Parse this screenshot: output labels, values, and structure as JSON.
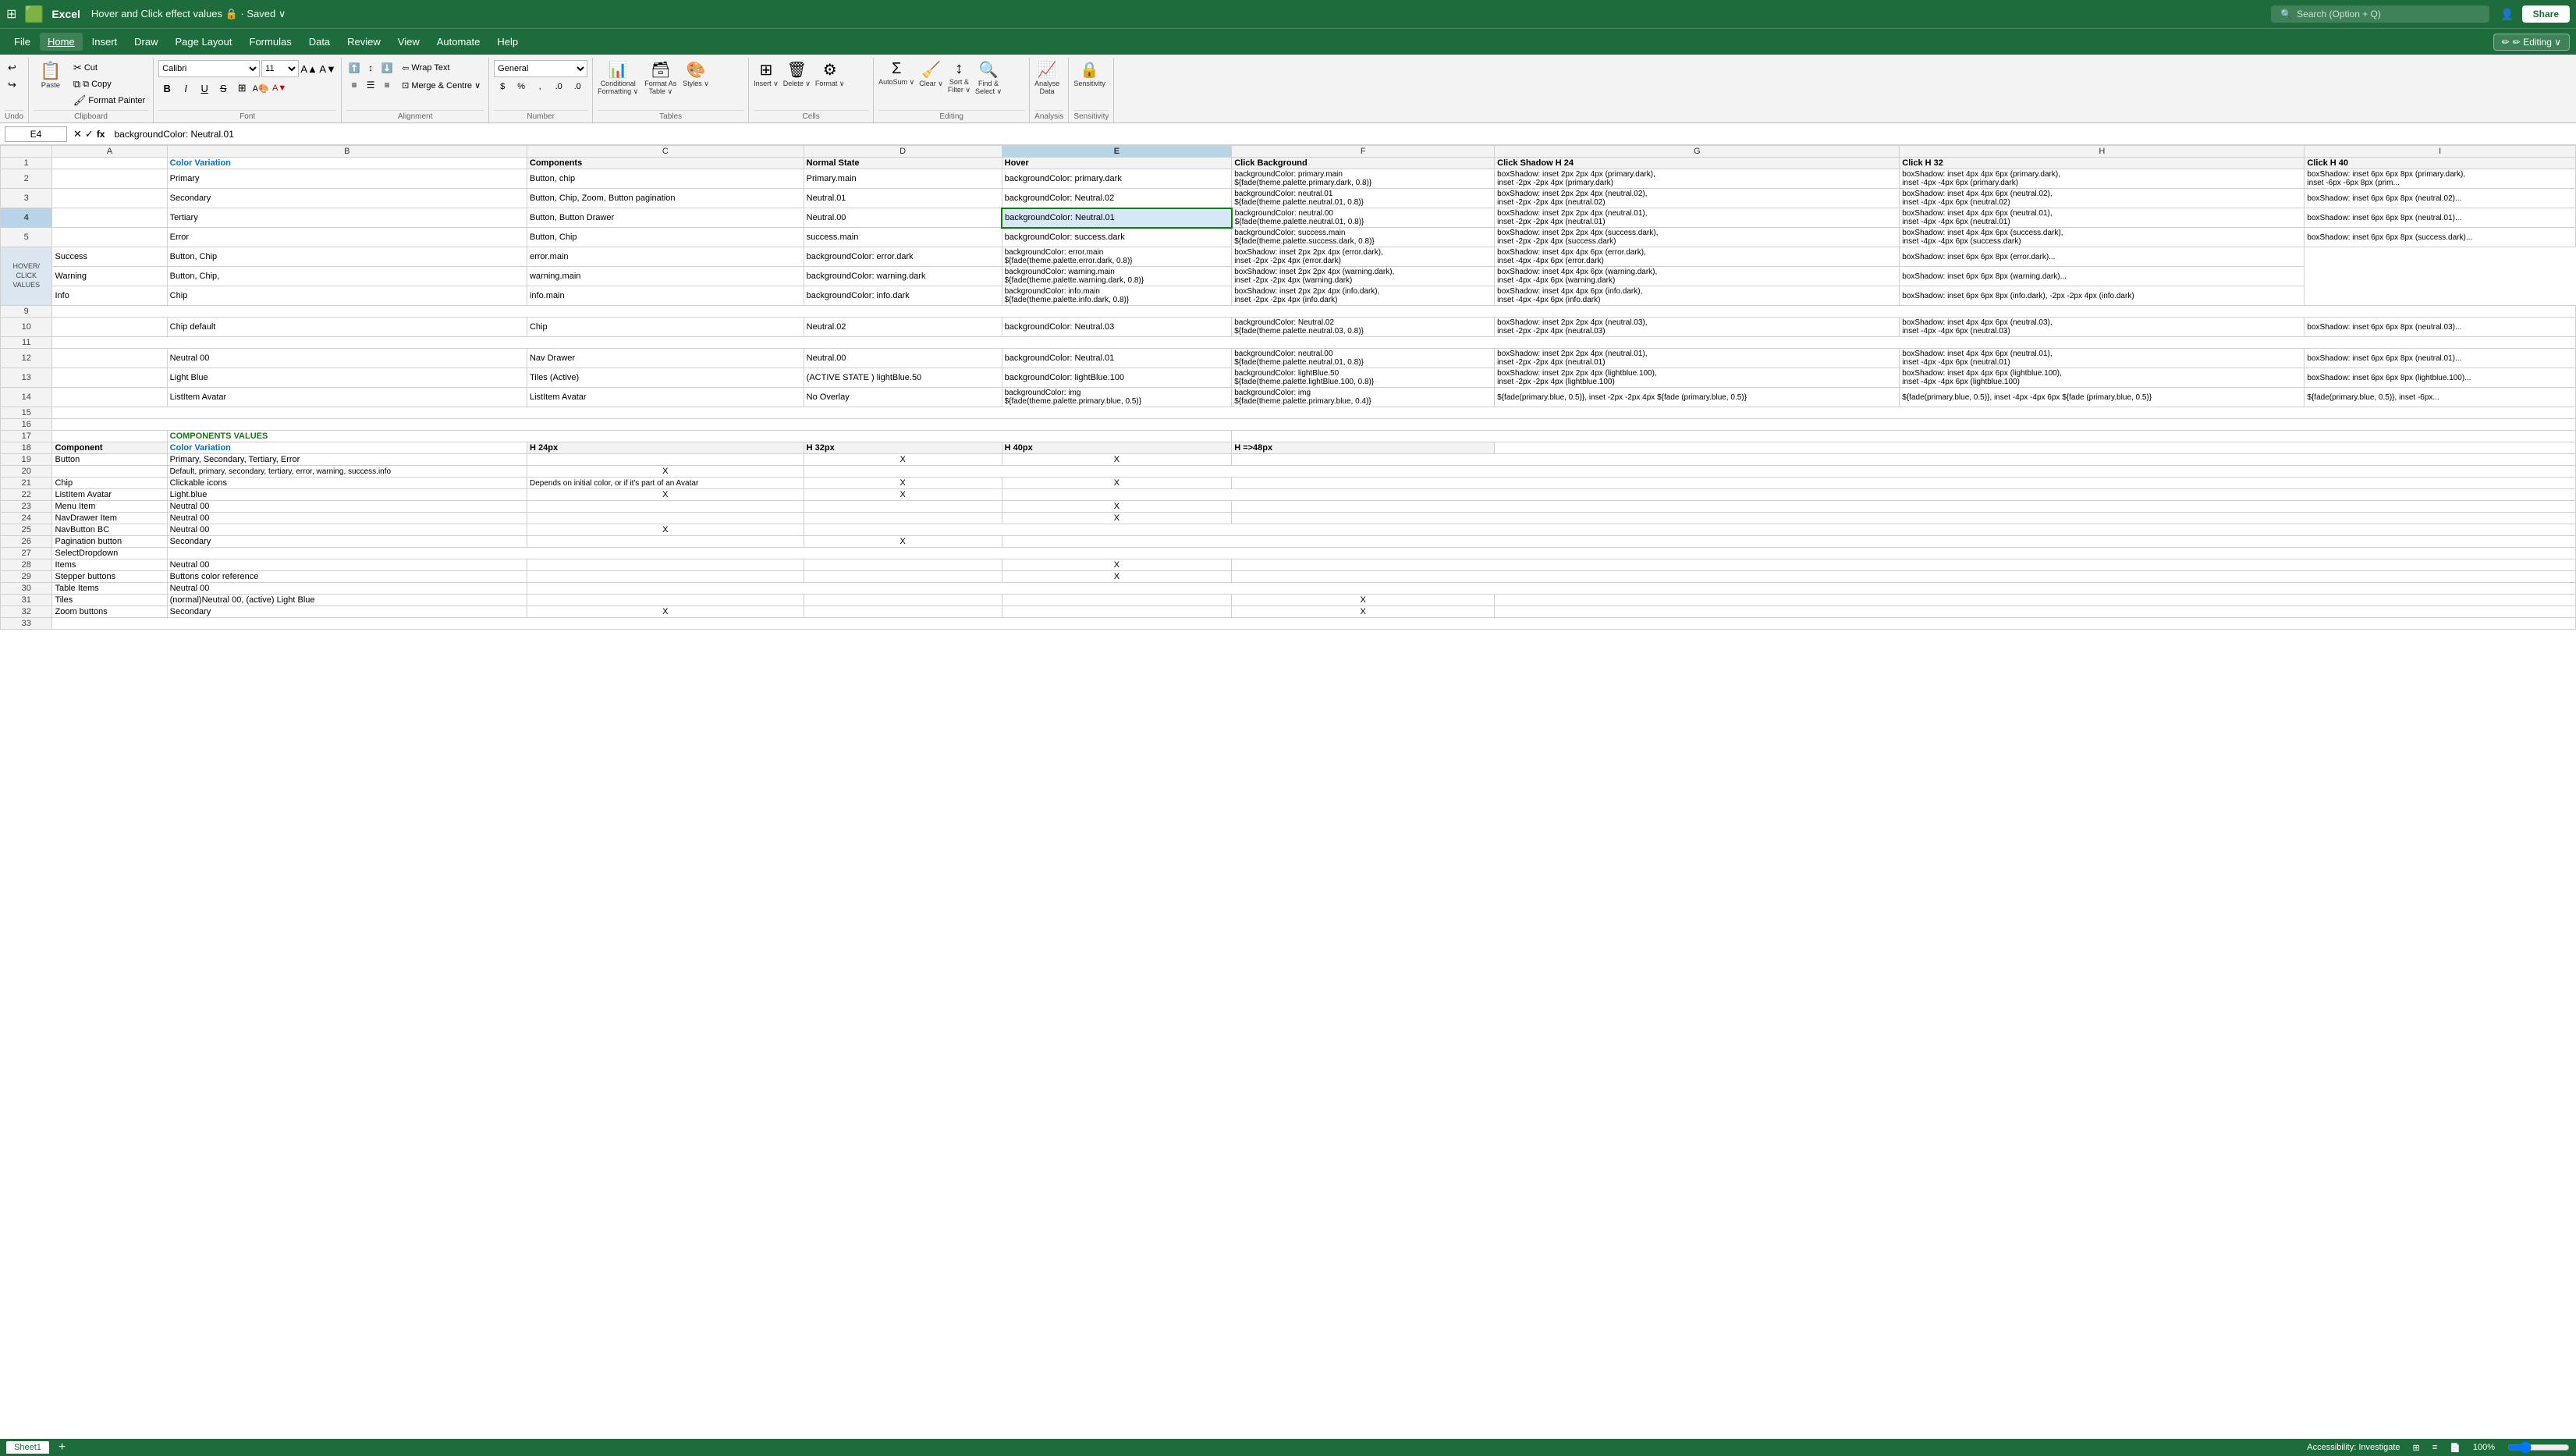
{
  "titleBar": {
    "appIcon": "⊞",
    "appName": "Excel",
    "docTitle": "Hover and Click effect values  🔒 · Saved ∨",
    "searchPlaceholder": "Search (Option + Q)",
    "shareLabel": "Share",
    "editingLabel": "✏ Editing ∨"
  },
  "menuBar": {
    "items": [
      "File",
      "Home",
      "Insert",
      "Draw",
      "Page Layout",
      "Formulas",
      "Data",
      "Review",
      "View",
      "Automate",
      "Help"
    ]
  },
  "ribbon": {
    "groups": {
      "undo": {
        "label": "Undo",
        "items": [
          "↩ Undo",
          "↪ Redo"
        ]
      },
      "clipboard": {
        "label": "Clipboard",
        "paste": "Paste",
        "cut": "✂ Cut",
        "copy": "⧉ Copy",
        "painter": "🖌 Format Painter"
      },
      "font": {
        "label": "Font",
        "name": "Calibri",
        "size": "11"
      },
      "alignment": {
        "label": "Alignment"
      },
      "wrapText": "Wrap Text",
      "mergeCentre": "Merge & Centre",
      "number": {
        "label": "Number",
        "format": "General"
      },
      "tables": {
        "label": "Tables"
      },
      "cells": {
        "label": "Cells"
      },
      "editing": {
        "label": "Editing",
        "autosum": "AutoSum",
        "clear": "Clear",
        "sortFilter": "Sort & Filter",
        "findSelect": "Find & Select"
      },
      "analysis": {
        "label": "Analysis",
        "analyseData": "Analyse Data"
      },
      "sensitivity": {
        "label": "Sensitivity"
      }
    }
  },
  "formulaBar": {
    "cellRef": "E4",
    "formula": "backgroundColor: Neutral.01"
  },
  "columns": {
    "widths": [
      28,
      80,
      160,
      260,
      130,
      195,
      180,
      175,
      185,
      140
    ],
    "labels": [
      "",
      "A",
      "B",
      "C",
      "D",
      "E",
      "F",
      "G",
      "H"
    ]
  },
  "rows": {
    "headers": [
      "1",
      "2",
      "3",
      "4",
      "5",
      "6",
      "7",
      "8",
      "9",
      "10",
      "11",
      "12",
      "13",
      "14",
      "15",
      "16",
      "17",
      "18",
      "19",
      "20",
      "21",
      "22",
      "23",
      "24",
      "25",
      "26",
      "27",
      "28",
      "29",
      "30",
      "31",
      "32",
      "33"
    ]
  },
  "spreadsheet": {
    "row1": {
      "A": "",
      "B": "Color Variation",
      "C": "Components",
      "D": "Normal State",
      "E": "Hover",
      "F": "Click Background",
      "G": "Click Shadow H 24",
      "H": "Click H 32",
      "I": "Click H 40"
    },
    "row2": {
      "B": "Primary",
      "C": "Button, chip",
      "D": "Primary.main",
      "E": "backgroundColor: primary.dark",
      "F": "backgroundColor: primary.main\n${fade(theme.palette.primary.dark, 0.8)}",
      "G": "boxShadow: inset 2px 2px 4px (primary.dark), inset -2px -2px 4px (primary.dark)",
      "H": "boxShadow: inset 4px 4px 6px (primary.dark), inset -4px -4px 6px (primary.dark)",
      "I": "boxShadow: inset 6px 6px 8px (primary.dark), inset -6px -6px 8px (prim..."
    },
    "row3": {
      "B": "Secondary",
      "C": "Button, Chip, Zoom, Button pagination",
      "D": "Neutral.01",
      "E": "backgroundColor: Neutral.02",
      "F": "backgroundColor: neutral.01\n${fade(theme.palette.neutral.01, 0.8)}",
      "G": "boxShadow: inset 2px 2px 4px (neutral.02), inset -2px -2px 4px (neutral.02)",
      "H": "boxShadow: inset 4px 4px 6px (neutral.02), inset -4px -4px 6px (neutral.02)",
      "I": "boxShadow: inset 6px 6px 8px (neutral.02), inset -6px -6px..."
    },
    "row4": {
      "B": "Tertiary",
      "C": "Button, Button Drawer",
      "D": "Neutral.00",
      "E": "backgroundColor: Neutral.01",
      "F": "backgroundColor: neutral.00\n${fade(theme.palette.neutral.01, 0.8)}",
      "G": "boxShadow: inset 2px 2px 4px (neutral.01), inset -2px -2px 4px (neutral.01)",
      "H": "boxShadow: inset 4px 4px 6px (neutral.01), inset -4px -4px 6px (neutral.01)",
      "I": "boxShadow: inset 6px 6px 8px (neutral.01),..."
    },
    "row5": {
      "B": "Error",
      "C": "Button, Chip",
      "D": "success.main",
      "E": "backgroundColor: success.dark",
      "F": "backgroundColor: success.main\n${fade(theme.palette.success.dark, 0.8)}",
      "G": "boxShadow: inset 2px 2px 4px (success.dark), inset -2px -2px 4px (success.dark)",
      "H": "boxShadow: inset 4px 4px 6px (success.dark), inset -4px -4px 6px (success.dark)",
      "I": "boxShadow: inset 6px 6px 8px (success.dark),..."
    },
    "row6": {
      "A": "HOVER/ CLICK VALUES",
      "B": "Success",
      "C": "Button, Chip",
      "D": "error.main",
      "E": "backgroundColor: error.dark",
      "F": "backgroundColor: error.main\n${fade(theme.palette.error.dark, 0.8)}",
      "G": "boxShadow: inset 2px 2px 4px (error.dark), inset -2px -2px 4px (error.dark)",
      "H": "boxShadow: inset 4px 4px 6px (error.dark), inset -4px -4px 6px (error.dark)",
      "I": "boxShadow: inset 6px 6px 8px (error.dark),..."
    },
    "row7": {
      "B": "Warning",
      "C": "Button, Chip,",
      "D": "warning.main",
      "E": "backgroundColor: warning.dark",
      "F": "backgroundColor: warning.main\n${fade(theme.palette.warning.dark, 0.8)}",
      "G": "boxShadow: inset 2px 2px 4px (warning.dark), inset -2px -2px 4px (warning.dark)",
      "H": "boxShadow: inset 4px 4px 6px (warning.dark), inset -4px -4px 6px (warning.dark)",
      "I": "boxShadow: inset 6px 6px 8px (warning.dark),..."
    },
    "row8": {
      "B": "Info",
      "C": "Chip",
      "D": "info.main",
      "E": "backgroundColor: info.dark",
      "F": "backgroundColor: info.main\n${fade(theme.palette.info.dark, 0.8)}",
      "G": "boxShadow: inset 2px 2px 4px (info.dark), inset -2px -2px 4px (info.dark)",
      "H": "boxShadow: inset 4px 4px 6px (info.dark), inset -4px -4px 6px (info.dark)",
      "I": "boxShadow: inset 6px 6px 8px (info.dark), -2px -2px 4px (info.dark)"
    },
    "row9": {},
    "row10": {
      "B": "Chip default",
      "C": "Chip",
      "D": "Neutral.02",
      "E": "backgroundColor: Neutral.03",
      "F": "backgroundColor: Neutral.02\n${fade(theme.palette.neutral.03, 0.8)}",
      "G": "boxShadow: inset 2px 2px 4px (neutral.03), inset -2px -2px 4px (neutral.03)",
      "H": "boxShadow: inset 4px 4px 6px (neutral.03), inset -4px -4px 6px (neutral.03)",
      "I": "boxShadow: inset 6px 6px 8px (neutral.03),..."
    },
    "row11": {},
    "row12": {
      "B": "Neutral 00",
      "C": "Nav Drawer",
      "D": "Neutral.00",
      "E": "backgroundColor: Neutral.01",
      "F": "backgroundColor: neutral.00\n${fade(theme.palette.neutral.01, 0.8)}",
      "G": "boxShadow: inset 2px 2px 4px (neutral.01), inset -2px -2px 4px (neutral.01)",
      "H": "boxShadow: inset 4px 4px 6px (neutral.01), inset -4px -4px 6px (neutral.01)",
      "I": "boxShadow: inset 6px 6px 8px (neutral.01),..."
    },
    "row13": {
      "B": "Light Blue",
      "C": "Tiles (Active)",
      "D": "(ACTIVE STATE ) lightBlue.50",
      "E": "backgroundColor: lightBlue.100",
      "F": "backgroundColor: lightBlue.50\n${fade(theme.palette.lightBlue.100, 0.8)}",
      "G": "boxShadow: inset 2px 2px 4px (lightblue.100), inset -2px -2px 4px (lightblue.100)",
      "H": "boxShadow: inset 4px 4px 6px (lightblue.100), inset -4px -4px 6px (lightblue.100)",
      "I": "boxShadow: inset 6px 6px 8px (lightblue.100),..."
    },
    "row14": {
      "B": "ListItem Avatar",
      "C": "ListItem Avatar",
      "D": "No Overlay",
      "E": "backgroundColor: img\n${fade(theme.palette.primary.blue, 0.5)}",
      "F": "backgroundColor: img\n${fade(theme.palette.primary.blue, 0.4)}",
      "G": "${fade(primary.blue, 0.5)}, inset -2px -2px 4px ${fade (primary.blue, 0.5)}",
      "H": "${fade(primary.blue, 0.5)}, inset -4px -4px 6px ${fade (primary.blue, 0.5)}",
      "I": "${fade(primary.blue, 0.5)}, inset -6px..."
    },
    "row15": {},
    "row16": {},
    "row17": {},
    "row18": {
      "A": "Component",
      "B": "Color Variation",
      "C": "H 24px",
      "D": "H 32px",
      "E": "H 40px",
      "F": "H =>48px"
    },
    "row19": {
      "A": "Button",
      "B": "Primary, Secondary, Tertiary, Error",
      "D": "X",
      "E": "X"
    },
    "row20": {
      "B": "Default, primary, secondary, tertiary, error, warning, success.info",
      "C": "X"
    },
    "row21": {
      "A": "Chip",
      "B": "Clickable icons",
      "C": "Depends on initial color, or if it's part of an  Avatar",
      "D": "X",
      "E": "X"
    },
    "row22": {
      "A": "ListItem Avatar",
      "B": "Light.blue",
      "C": "X",
      "D": "X"
    },
    "row23": {
      "A": "Menu Item",
      "B": "Neutral 00",
      "E": "X"
    },
    "row24": {
      "A": "NavDrawer Item",
      "B": "Neutral 00",
      "E": "X"
    },
    "row25": {
      "A": "NavButton BC",
      "B": "Neutral 00",
      "C": "X"
    },
    "row26": {
      "A": "Pagination button",
      "B": "Secondary",
      "D": "X"
    },
    "row27": {
      "A": "SelectDropdown"
    },
    "row28": {
      "A": "Items",
      "B": "Neutral 00",
      "E": "X"
    },
    "row29": {
      "A": "Stepper buttons",
      "B": "Buttons color reference",
      "E": "X"
    },
    "row30": {
      "A": "Table Items",
      "B": "Neutral 00"
    },
    "row31": {
      "A": "Tiles",
      "B": "(normal)Neutral 00, (active) Light Blue",
      "F": "X"
    },
    "row32": {
      "A": "Zoom buttons",
      "B": "Secondary",
      "C": "X",
      "F": "X"
    }
  },
  "statusBar": {
    "sheetName": "Sheet1",
    "accessibility": "Accessibility: Investigate",
    "zoom": "100%",
    "viewIcons": [
      "⊞",
      "≡",
      "📄"
    ]
  }
}
